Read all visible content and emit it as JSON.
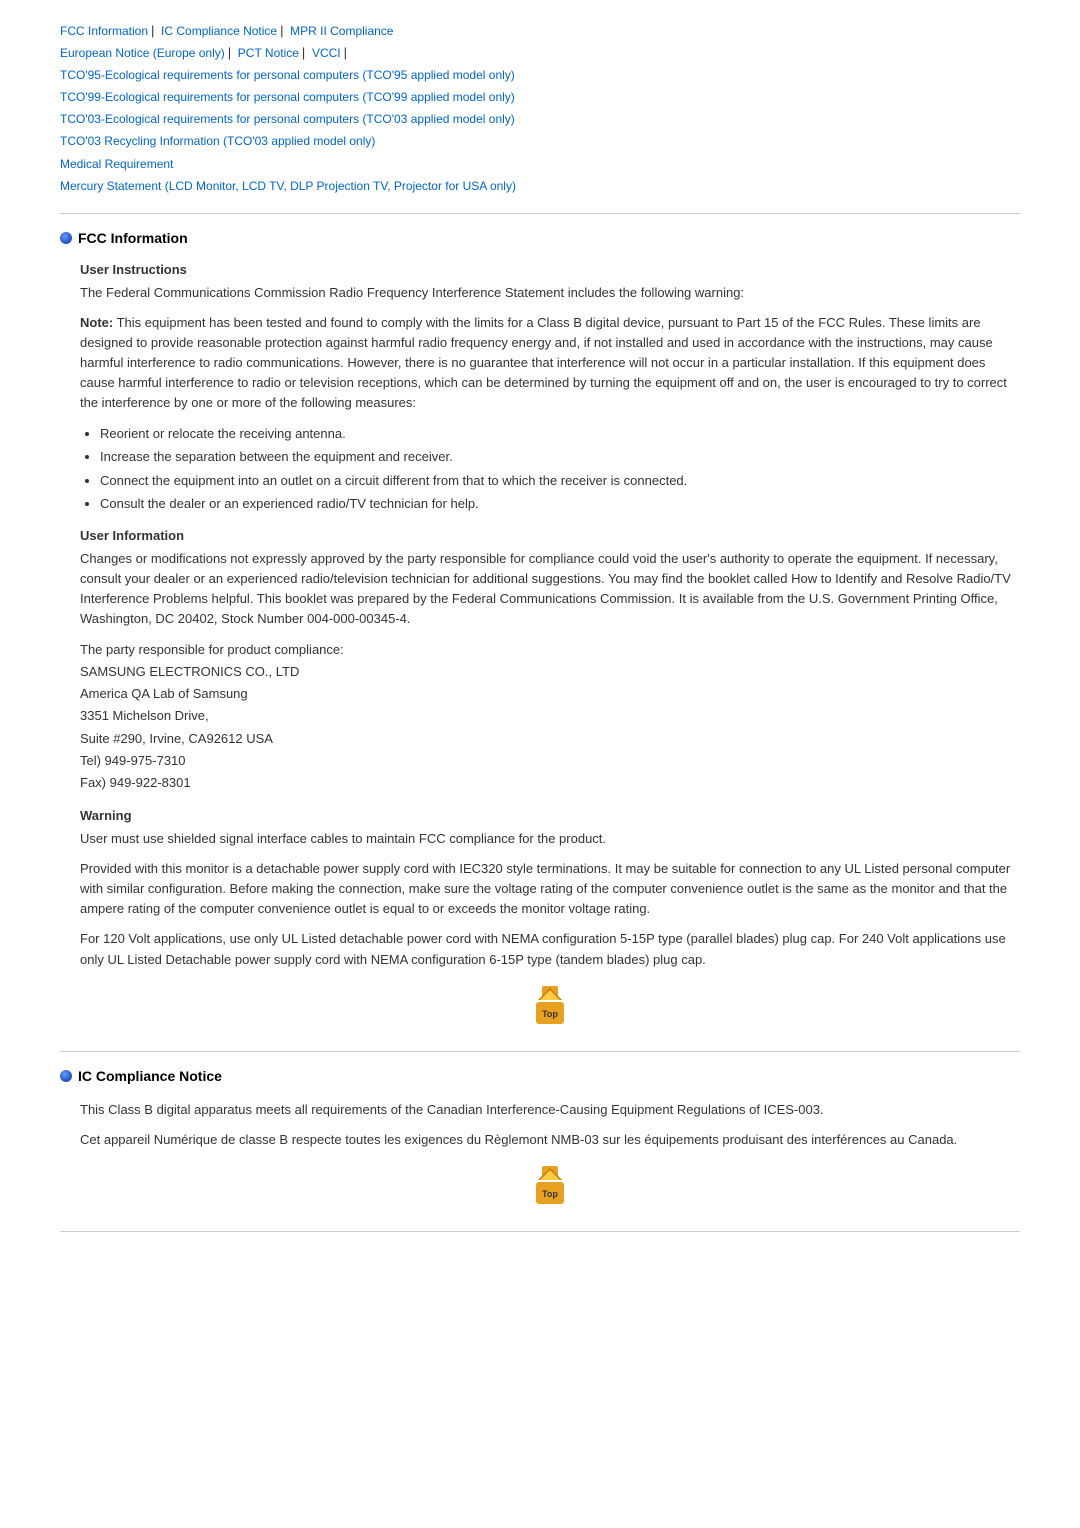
{
  "nav": {
    "links": [
      {
        "label": "FCC Information",
        "id": "fcc"
      },
      {
        "label": "IC Compliance Notice",
        "id": "ic"
      },
      {
        "label": "MPR II Compliance",
        "id": "mpr"
      },
      {
        "label": "European Notice (Europe only)",
        "id": "eu"
      },
      {
        "label": "PCT Notice",
        "id": "pct"
      },
      {
        "label": "VCCI",
        "id": "vcci"
      },
      {
        "label": "TCO'95-Ecological requirements for personal computers (TCO'95 applied model only)",
        "id": "tco95"
      },
      {
        "label": "TCO'99-Ecological requirements for personal computers (TCO'99 applied model only)",
        "id": "tco99"
      },
      {
        "label": "TCO'03-Ecological requirements for personal computers (TCO'03 applied model only)",
        "id": "tco03"
      },
      {
        "label": "TCO'03 Recycling Information (TCO'03 applied model only)",
        "id": "tco03r"
      },
      {
        "label": "Medical Requirement",
        "id": "medical"
      },
      {
        "label": "Mercury Statement (LCD Monitor, LCD TV, DLP Projection TV, Projector for USA only)",
        "id": "mercury"
      }
    ]
  },
  "sections": {
    "fcc": {
      "title": "FCC Information",
      "user_instructions": {
        "heading": "User Instructions",
        "intro": "The Federal Communications Commission Radio Frequency Interference Statement includes the following warning:",
        "note_prefix": "Note:",
        "note_body": " This equipment has been tested and found to comply with the limits for a Class B digital device, pursuant to Part 15 of the FCC Rules. These limits are designed to provide reasonable protection against harmful radio frequency energy and, if not installed and used in accordance with the instructions, may cause harmful interference to radio communications. However, there is no guarantee that interference will not occur in a particular installation. If this equipment does cause harmful interference to radio or television receptions, which can be determined by turning the equipment off and on, the user is encouraged to try to correct the interference by one or more of the following measures:",
        "measures": [
          "Reorient or relocate the receiving antenna.",
          "Increase the separation between the equipment and receiver.",
          "Connect the equipment into an outlet on a circuit different from that to which the receiver is connected.",
          "Consult the dealer or an experienced radio/TV technician for help."
        ]
      },
      "user_information": {
        "heading": "User Information",
        "para1": "Changes or modifications not expressly approved by the party responsible for compliance could void the user's authority to operate the equipment. If necessary, consult your dealer or an experienced radio/television technician for additional suggestions. You may find the booklet called How to Identify and Resolve Radio/TV Interference Problems helpful. This booklet was prepared by the Federal Communications Commission. It is available from the U.S. Government Printing Office, Washington, DC 20402, Stock Number 004-000-00345-4.",
        "party_label": "The party responsible for product compliance:",
        "company": "SAMSUNG ELECTRONICS CO., LTD",
        "address_lines": [
          "America QA Lab of Samsung",
          "3351 Michelson Drive,",
          "Suite #290, Irvine, CA92612 USA",
          "Tel) 949-975-7310",
          "Fax) 949-922-8301"
        ]
      },
      "warning": {
        "heading": "Warning",
        "para1": "User must use shielded signal interface cables to maintain FCC compliance for the product.",
        "para2": "Provided with this monitor is a detachable power supply cord with IEC320 style terminations. It may be suitable for connection to any UL Listed personal computer with similar configuration. Before making the connection, make sure the voltage rating of the computer convenience outlet is the same as the monitor and that the ampere rating of the computer convenience outlet is equal to or exceeds the monitor voltage rating.",
        "para3": "For 120 Volt applications, use only UL Listed detachable power cord with NEMA configuration 5-15P type (parallel blades) plug cap. For 240 Volt applications use only UL Listed Detachable power supply cord with NEMA configuration 6-15P type (tandem blades) plug cap."
      }
    },
    "ic": {
      "title": "IC Compliance Notice",
      "para1": "This Class B digital apparatus meets all requirements of the Canadian Interference-Causing Equipment Regulations of ICES-003.",
      "para2": "Cet appareil Numérique de classe B respecte toutes les exigences du Règlemont NMB-03 sur les équipements produisant des interférences au Canada."
    }
  },
  "top_button_label": "Top"
}
